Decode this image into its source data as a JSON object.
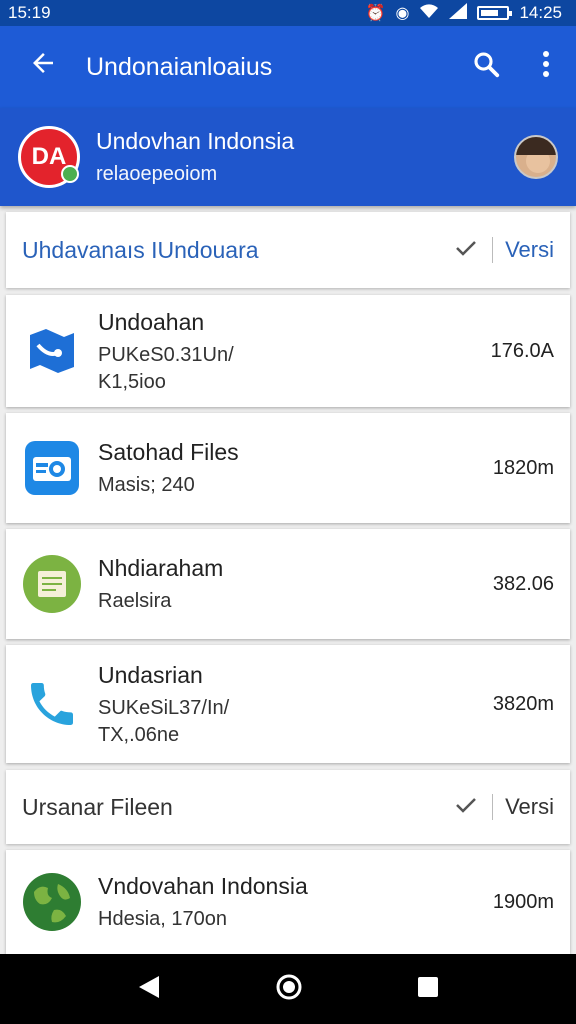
{
  "status": {
    "time_left": "15:19",
    "time_right": "14:25"
  },
  "app_bar": {
    "title": "Undonaianloaius"
  },
  "header": {
    "title": "Undovhan Indonsia",
    "subtitle": "relaoepeoiom",
    "logo_text": "DA"
  },
  "section1": {
    "title": "Uhdavanaıs IUndouara",
    "version_label": "Versi"
  },
  "items": [
    {
      "name": "Undoahan",
      "sub1": "PUKeS0.31Un/",
      "sub2": "K1,5ioo",
      "size": "176.0A",
      "icon": "map-icon"
    },
    {
      "name": "Satohad Files",
      "sub1": "Masis; 240",
      "size": "1820m",
      "icon": "camera-folder-icon"
    },
    {
      "name": "Nhdiaraham",
      "sub1": "Raelsira",
      "size": "382.06",
      "icon": "document-icon"
    },
    {
      "name": "Undasrian",
      "sub1": "SUKeSiL37/In/",
      "sub2": "TX,.06ne",
      "size": "3820m",
      "icon": "phone-icon"
    }
  ],
  "section2": {
    "title": "Ursanar Fileen",
    "version_label": "Versi"
  },
  "item5": {
    "name": "Vndovahan Indonsia",
    "sub1": "Hdesia, 170on",
    "size": "1900m",
    "icon": "globe-icon"
  },
  "colors": {
    "primary": "#1e5bd6",
    "status_bar": "#0d47a1",
    "accent": "#2a62b8"
  }
}
